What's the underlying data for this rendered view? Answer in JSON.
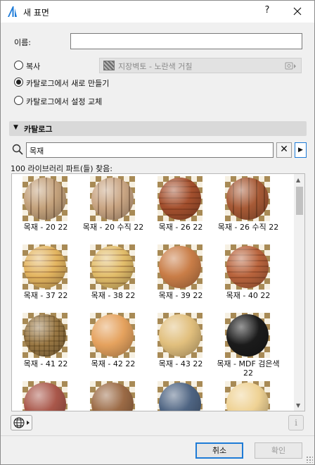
{
  "window": {
    "title": "새 표면",
    "help_label": "?",
    "close_label": "✕"
  },
  "form": {
    "name_label": "이름:",
    "name_value": "",
    "options": [
      {
        "label": "복사",
        "checked": false
      },
      {
        "label": "카탈로그에서 새로 만들기",
        "checked": true
      },
      {
        "label": "카탈로그에서 설정 교체",
        "checked": false
      }
    ],
    "copy_source": "지장벽토 - 노란색 거칠"
  },
  "catalog": {
    "section_label": "카탈로그",
    "search_value": "목재",
    "clear_label": "✕",
    "results_text": "100 라이브러리 파트(들) 찾음:",
    "items": [
      {
        "label": "목재 - 20 22",
        "color": "#c4a27c",
        "pattern": "striped"
      },
      {
        "label": "목재 - 20 수직 22",
        "color": "#c9a583",
        "pattern": "striped"
      },
      {
        "label": "목재 - 26 22",
        "color": "#a4502e",
        "pattern": "banded"
      },
      {
        "label": "목재 - 26 수직 22",
        "color": "#a75a36",
        "pattern": "striped"
      },
      {
        "label": "목재 - 37 22",
        "color": "#e3b560",
        "pattern": "banded"
      },
      {
        "label": "목재 - 38 22",
        "color": "#e2bd6a",
        "pattern": "banded"
      },
      {
        "label": "목재 - 39 22",
        "color": "#c97d47",
        "pattern": "plain"
      },
      {
        "label": "목재 - 40 22",
        "color": "#b9643d",
        "pattern": "banded"
      },
      {
        "label": "목재 - 41 22",
        "color": "#9a7844",
        "pattern": "checker"
      },
      {
        "label": "목재 - 42 22",
        "color": "#e5a25e",
        "pattern": "plain"
      },
      {
        "label": "목재 - 43 22",
        "color": "#e1bf7d",
        "pattern": "plain"
      },
      {
        "label": "목재 - MDF 검은색 22",
        "color": "#1b1b1b",
        "pattern": "plain"
      },
      {
        "label": "",
        "color": "#a9574a",
        "pattern": "plain"
      },
      {
        "label": "",
        "color": "#9b6a45",
        "pattern": "plain"
      },
      {
        "label": "",
        "color": "#4e6482",
        "pattern": "plain"
      },
      {
        "label": "",
        "color": "#efd294",
        "pattern": "plain"
      }
    ]
  },
  "footer": {
    "info_label": "i",
    "cancel_label": "취소",
    "ok_label": "확인"
  }
}
